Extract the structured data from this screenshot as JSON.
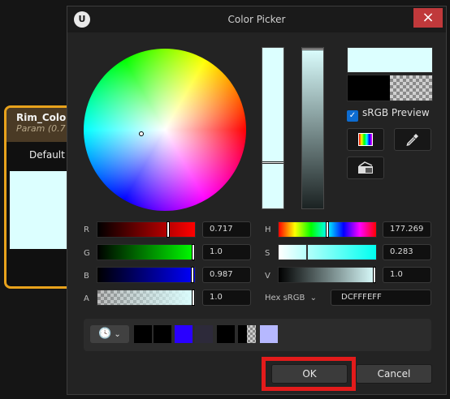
{
  "node": {
    "title": "Rim_Color",
    "subtitle": "Param (0.7",
    "default_label": "Default V"
  },
  "dialog": {
    "title": "Color Picker",
    "logo": "U",
    "close_icon": "×"
  },
  "preview": {
    "srgb_label": "sRGB Preview",
    "srgb_checked": true
  },
  "rgba": [
    {
      "label": "R",
      "value": "0.717"
    },
    {
      "label": "G",
      "value": "1.0"
    },
    {
      "label": "B",
      "value": "0.987"
    },
    {
      "label": "A",
      "value": "1.0"
    }
  ],
  "hsv": [
    {
      "label": "H",
      "value": "177.269"
    },
    {
      "label": "S",
      "value": "0.283"
    },
    {
      "label": "V",
      "value": "1.0"
    }
  ],
  "hex": {
    "label": "Hex sRGB",
    "value": "DCFFFEFF"
  },
  "buttons": {
    "ok": "OK",
    "cancel": "Cancel"
  },
  "colors": {
    "current": "#dcffff",
    "accent": "#0d6cd1",
    "highlight": "#e31b1b",
    "node_border": "#e8a21c"
  },
  "recent_colors": [
    "#000000",
    "#000000",
    "#2a00ff",
    "#2d2a3a",
    "#000000",
    "checker",
    "#b6b8ff"
  ]
}
